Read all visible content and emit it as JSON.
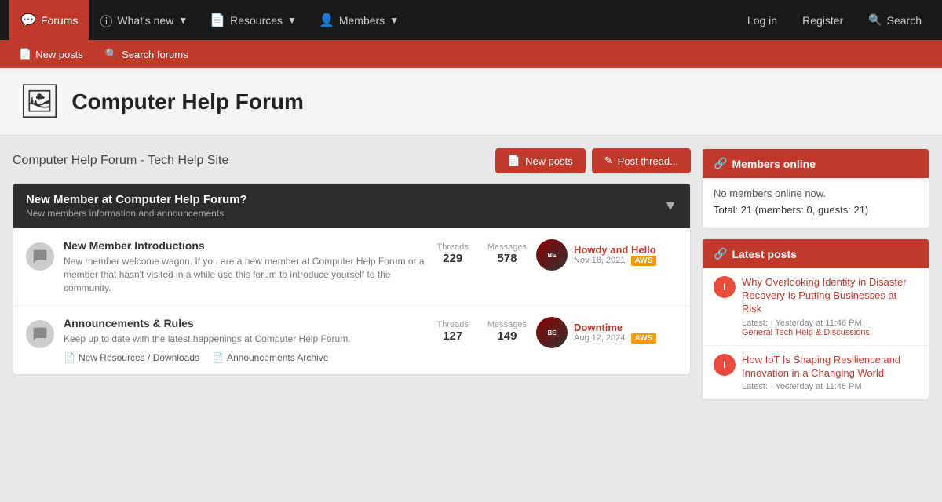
{
  "nav": {
    "forums_label": "Forums",
    "whats_new_label": "What's new",
    "resources_label": "Resources",
    "members_label": "Members",
    "login_label": "Log in",
    "register_label": "Register",
    "search_label": "Search"
  },
  "subnav": {
    "new_posts_label": "New posts",
    "search_forums_label": "Search forums"
  },
  "header": {
    "title": "Computer Help Forum"
  },
  "breadcrumb": "Computer Help Forum - Tech Help Site",
  "buttons": {
    "new_posts": "New posts",
    "post_thread": "Post thread..."
  },
  "section1": {
    "title": "New Member at Computer Help Forum?",
    "subtitle": "New members information and announcements.",
    "forum1": {
      "name": "New Member Introductions",
      "desc": "New member welcome wagon. If you are a new member at Computer Help Forum or a member that hasn't visited in a while use this forum to introduce yourself to the community.",
      "threads_label": "Threads",
      "threads_count": "229",
      "messages_label": "Messages",
      "messages_count": "578",
      "latest_title": "Howdy and Hello",
      "latest_date": "Nov 16, 2021",
      "latest_badge": "AWS"
    },
    "forum2": {
      "name": "Announcements & Rules",
      "desc": "Keep up to date with the latest happenings at Computer Help Forum.",
      "threads_label": "Threads",
      "threads_count": "127",
      "messages_label": "Messages",
      "messages_count": "149",
      "latest_title": "Downtime",
      "latest_date": "Aug 12, 2024",
      "latest_badge": "AWS",
      "sub1_label": "New Resources / Downloads",
      "sub2_label": "Announcements Archive"
    }
  },
  "sidebar": {
    "members_online_title": "Members online",
    "members_online_none": "No members online now.",
    "members_total": "Total: 21 (members: 0, guests: 21)",
    "latest_posts_title": "Latest posts",
    "posts": [
      {
        "avatar_letter": "I",
        "title": "Why Overlooking Identity in Disaster Recovery Is Putting Businesses at Risk",
        "meta": "Latest: · Yesterday at 11:46 PM",
        "section": "General Tech Help & Discussions"
      },
      {
        "avatar_letter": "I",
        "title": "How IoT Is Shaping Resilience and Innovation in a Changing World",
        "meta": "Latest: · Yesterday at 11:46 PM",
        "section": ""
      }
    ]
  }
}
